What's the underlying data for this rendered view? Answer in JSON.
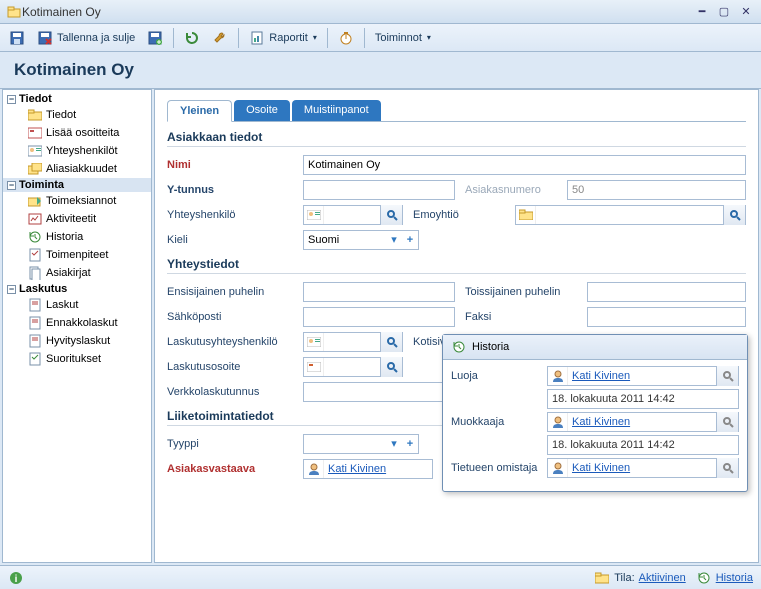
{
  "window": {
    "title": "Kotimainen Oy"
  },
  "toolbar": {
    "save_close": "Tallenna ja sulje",
    "reports": "Raportit",
    "actions": "Toiminnot"
  },
  "header": {
    "title": "Kotimainen Oy"
  },
  "sidebar": {
    "groups": [
      {
        "label": "Tiedot",
        "items": [
          "Tiedot",
          "Lisää osoitteita",
          "Yhteyshenkilöt",
          "Aliasiakkuudet"
        ]
      },
      {
        "label": "Toiminta",
        "items": [
          "Toimeksiannot",
          "Aktiviteetit",
          "Historia",
          "Toimenpiteet",
          "Asiakirjat"
        ]
      },
      {
        "label": "Laskutus",
        "items": [
          "Laskut",
          "Ennakkolaskut",
          "Hyvityslaskut",
          "Suoritukset"
        ]
      }
    ]
  },
  "tabs": [
    "Yleinen",
    "Osoite",
    "Muistiinpanot"
  ],
  "sections": {
    "s1": "Asiakkaan tiedot",
    "s2": "Yhteystiedot",
    "s3": "Liiketoimintatiedot"
  },
  "fields": {
    "nimi_label": "Nimi",
    "nimi_value": "Kotimainen Oy",
    "ytunnus_label": "Y-tunnus",
    "ytunnus_value": "",
    "asiakasnumero_label": "Asiakasnumero",
    "asiakasnumero_value": "50",
    "yhteyshenkilo_label": "Yhteyshenkilö",
    "emoyhtio_label": "Emoyhtiö",
    "kieli_label": "Kieli",
    "kieli_value": "Suomi",
    "ens_puhelin_label": "Ensisijainen puhelin",
    "tois_puhelin_label": "Toissijainen puhelin",
    "sahkoposti_label": "Sähköposti",
    "faksi_label": "Faksi",
    "lasku_yht_label": "Laskutusyhteyshenkilö",
    "kotisivu_label": "Kotisivu",
    "lasku_os_label": "Laskutusosoite",
    "verkko_label": "Verkkolaskutunnus",
    "tyyppi_label": "Tyyppi",
    "vastaava_label": "Asiakasvastaava",
    "vastaava_value": "Kati Kivinen"
  },
  "popup": {
    "title": "Historia",
    "luoja_label": "Luoja",
    "luoja_value": "Kati Kivinen",
    "luoja_ts": "18. lokakuuta 2011 14:42",
    "muokkaaja_label": "Muokkaaja",
    "muokkaaja_value": "Kati Kivinen",
    "muokkaaja_ts": "18. lokakuuta 2011 14:42",
    "omistaja_label": "Tietueen omistaja",
    "omistaja_value": "Kati Kivinen"
  },
  "statusbar": {
    "tila_prefix": "Tila:",
    "tila": "Aktiivinen",
    "historia": "Historia"
  }
}
